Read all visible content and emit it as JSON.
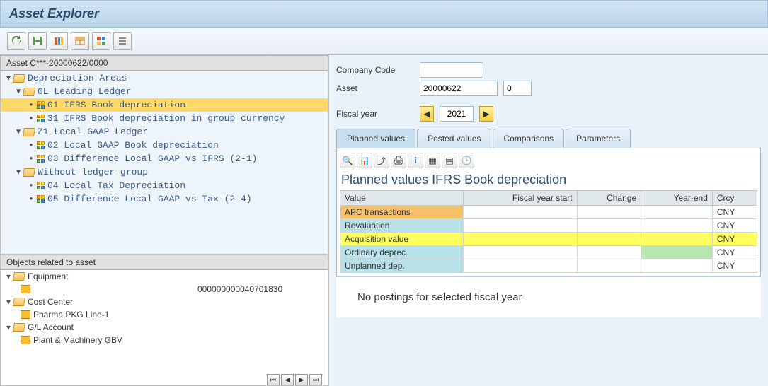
{
  "title": "Asset Explorer",
  "toolbar_icons": [
    "refresh",
    "save",
    "columns",
    "table",
    "grid",
    "list"
  ],
  "tree_header": "Asset C***-20000622/0000",
  "tree": {
    "root": "Depreciation Areas",
    "ledgers": [
      {
        "label": "0L Leading Ledger",
        "items": [
          {
            "code": "01",
            "label": "01 IFRS Book depreciation",
            "selected": true
          },
          {
            "code": "31",
            "label": "31 IFRS Book depreciation in group currency"
          }
        ]
      },
      {
        "label": "Z1 Local GAAP Ledger",
        "items": [
          {
            "code": "02",
            "label": "02 Local GAAP Book depreciation"
          },
          {
            "code": "03",
            "label": "03 Difference Local GAAP vs IFRS (2-1)"
          }
        ]
      },
      {
        "label": "Without ledger group",
        "items": [
          {
            "code": "04",
            "label": "04 Local Tax Depreciation"
          },
          {
            "code": "05",
            "label": "05 Difference Local GAAP vs Tax (2-4)"
          }
        ]
      }
    ]
  },
  "objects_header": "Objects related to asset",
  "objects": [
    {
      "type": "folder",
      "label": "Equipment"
    },
    {
      "type": "item",
      "label": "",
      "value": "000000000040701830"
    },
    {
      "type": "folder",
      "label": "Cost Center"
    },
    {
      "type": "item",
      "label": "Pharma PKG Line-1",
      "value": ""
    },
    {
      "type": "folder",
      "label": "G/L Account"
    },
    {
      "type": "item",
      "label": "Plant & Machinery GBV",
      "value": ""
    }
  ],
  "form": {
    "company_code_lbl": "Company Code",
    "company_code_val": "",
    "company_desc": "",
    "asset_lbl": "Asset",
    "asset_val": "20000622",
    "asset_sub": "0",
    "fiscal_lbl": "Fiscal year",
    "fiscal_val": "2021"
  },
  "tabs": [
    "Planned values",
    "Posted values",
    "Comparisons",
    "Parameters"
  ],
  "active_tab": 0,
  "section_title": "Planned values IFRS Book depreciation",
  "grid": {
    "cols": [
      "Value",
      "Fiscal year start",
      "Change",
      "Year-end",
      "Crcy"
    ],
    "rows": [
      {
        "label": "APC transactions",
        "fys": "",
        "chg": "",
        "ye": "",
        "crcy": "CNY",
        "cls": "apc"
      },
      {
        "label": "Revaluation",
        "fys": "",
        "chg": "",
        "ye": "",
        "crcy": "CNY"
      },
      {
        "label": "Acquisition value",
        "fys": "",
        "chg": "",
        "ye": "",
        "crcy": "CNY",
        "hl": true
      },
      {
        "label": "Ordinary deprec.",
        "fys": "",
        "chg": "",
        "ye": "",
        "crcy": "CNY"
      },
      {
        "label": "Unplanned dep.",
        "fys": "",
        "chg": "",
        "ye": "",
        "crcy": "CNY"
      }
    ]
  },
  "message": "No postings for selected fiscal year"
}
